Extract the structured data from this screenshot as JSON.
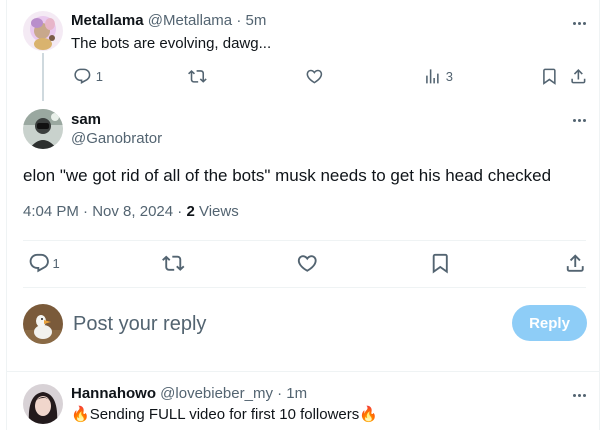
{
  "parent_tweet": {
    "name": "Metallama",
    "handle": "@Metallama",
    "separator": "·",
    "time": "5m",
    "text": "The bots are evolving, dawg...",
    "reply_count": "1",
    "retweet_count": "",
    "like_count": "",
    "views_count": "3"
  },
  "main_tweet": {
    "name": "sam",
    "handle": "@Ganobrator",
    "text": "elon \"we got rid of all of the bots\" musk needs to get his head checked",
    "time": "4:04 PM",
    "date": "Nov 8, 2024",
    "separator": "·",
    "views_count": "2",
    "views_label": "Views",
    "reply_count": "1"
  },
  "composer": {
    "placeholder": "Post your reply",
    "button_label": "Reply"
  },
  "next_reply": {
    "name": "Hannahowo",
    "handle": "@lovebieber_my",
    "separator": "·",
    "time": "1m",
    "emoji": "🔥",
    "text": "Sending FULL video for first 10 followers"
  },
  "icons": {
    "reply": "reply-icon",
    "retweet": "retweet-icon",
    "like": "like-icon",
    "views": "views-icon",
    "bookmark": "bookmark-icon",
    "share": "share-icon",
    "more": "more-icon",
    "fire": "fire-icon"
  },
  "colors": {
    "text": "#0f1419",
    "secondary": "#536471",
    "reply_button_disabled": "#8ecdf7",
    "divider": "#eff3f4",
    "thread_line": "#cfd9de"
  }
}
